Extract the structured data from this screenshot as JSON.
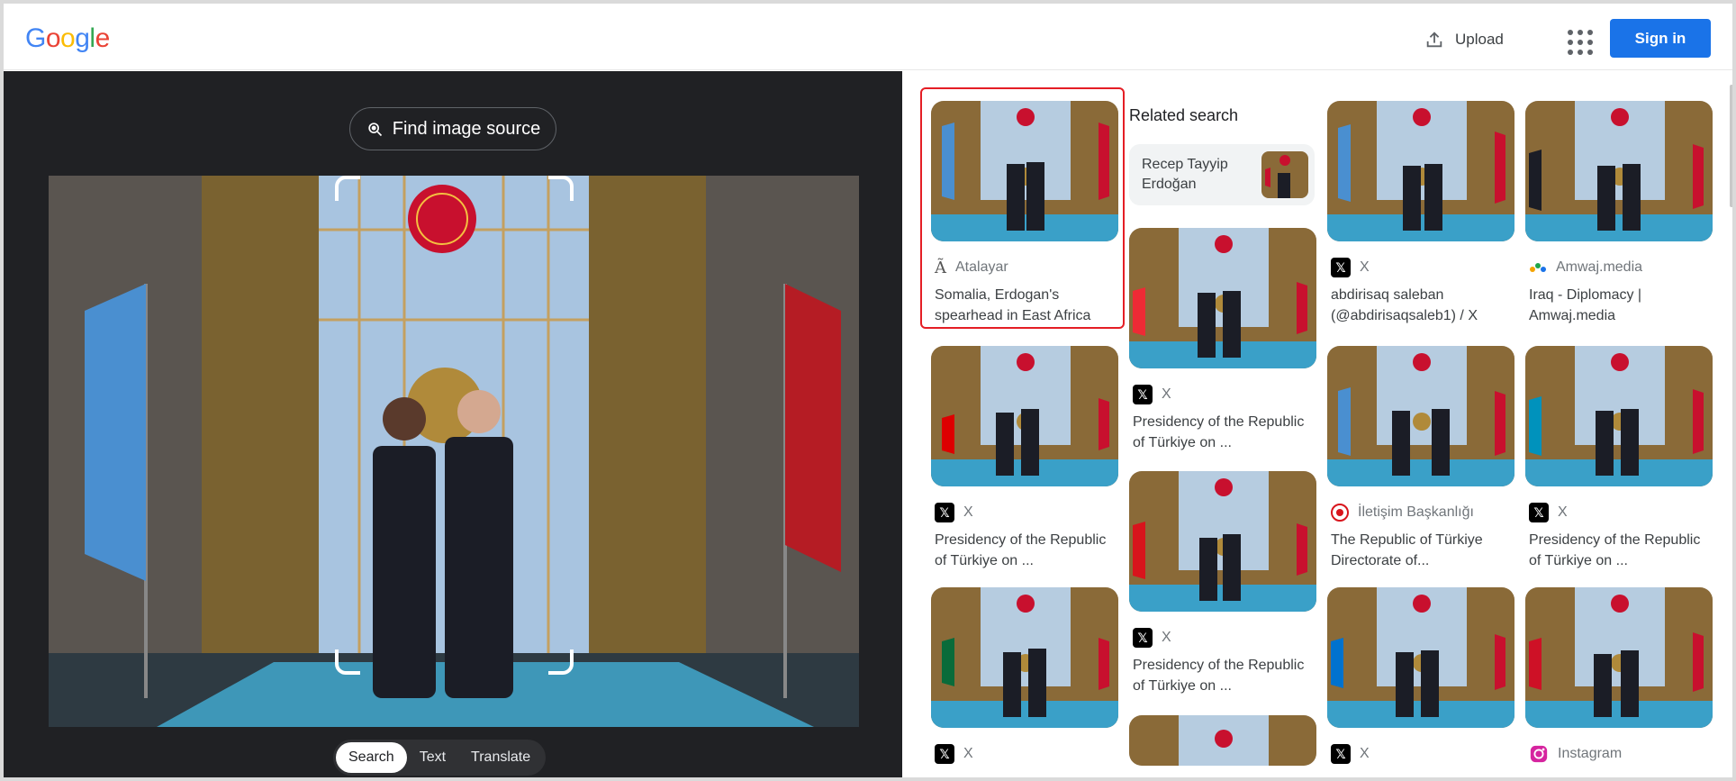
{
  "header": {
    "logo": "Google",
    "upload_label": "Upload",
    "signin_label": "Sign in"
  },
  "lens": {
    "find_source_label": "Find image source",
    "tabs": [
      "Search",
      "Text",
      "Translate"
    ],
    "active_tab": "Search"
  },
  "related": {
    "title": "Related search",
    "chip": "Recep Tayyip Erdoğan"
  },
  "results": [
    {
      "source": "Atalayar",
      "title": "Somalia, Erdogan's spearhead in East Africa"
    },
    {
      "source": "X",
      "title": "Presidency of the Republic of Türkiye on ..."
    },
    {
      "source": "X",
      "title": ""
    },
    {
      "source": "X",
      "title": "Presidency of the Republic of Türkiye on ..."
    },
    {
      "source": "X",
      "title": "Presidency of the Republic of Türkiye on ..."
    },
    {
      "source": "X",
      "title": "abdirisaq saleban (@abdirisaqsaleb1) / X"
    },
    {
      "source": "İletişim Başkanlığı",
      "title": "The Republic of Türkiye Directorate of..."
    },
    {
      "source": "X",
      "title": ""
    },
    {
      "source": "Amwaj.media",
      "title": "Iraq - Diplomacy | Amwaj.media"
    },
    {
      "source": "X",
      "title": "Presidency of the Republic of Türkiye on ..."
    },
    {
      "source": "Instagram",
      "title": ""
    }
  ]
}
